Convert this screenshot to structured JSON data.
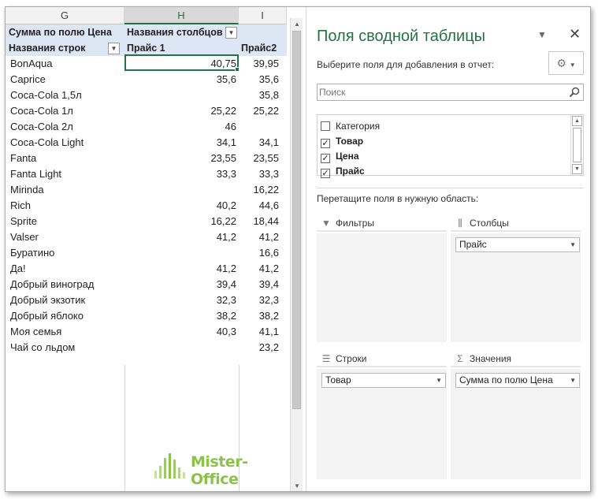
{
  "sheet": {
    "columns": [
      "G",
      "H",
      "I"
    ],
    "header_row1": {
      "g": "Сумма по полю Цена",
      "h": "Названия столбцов"
    },
    "header_row2": {
      "g": "Названия строк",
      "h": "Прайс 1",
      "i": "Прайс2"
    },
    "rows": [
      {
        "name": "BonAqua",
        "p1": "40,75",
        "p2": "39,95"
      },
      {
        "name": "Caprice",
        "p1": "35,6",
        "p2": "35,6"
      },
      {
        "name": "Coca-Cola 1,5л",
        "p1": "",
        "p2": "35,8"
      },
      {
        "name": "Coca-Cola 1л",
        "p1": "25,22",
        "p2": "25,22"
      },
      {
        "name": "Coca-Cola 2л",
        "p1": "46",
        "p2": ""
      },
      {
        "name": "Coca-Cola Light",
        "p1": "34,1",
        "p2": "34,1"
      },
      {
        "name": "Fanta",
        "p1": "23,55",
        "p2": "23,55"
      },
      {
        "name": "Fanta Light",
        "p1": "33,3",
        "p2": "33,3"
      },
      {
        "name": "Mirinda",
        "p1": "",
        "p2": "16,22"
      },
      {
        "name": "Rich",
        "p1": "40,2",
        "p2": "44,6"
      },
      {
        "name": "Sprite",
        "p1": "16,22",
        "p2": "18,44"
      },
      {
        "name": "Valser",
        "p1": "41,2",
        "p2": "41,2"
      },
      {
        "name": "Буратино",
        "p1": "",
        "p2": "16,6"
      },
      {
        "name": "Да!",
        "p1": "41,2",
        "p2": "41,2"
      },
      {
        "name": "Добрый виноград",
        "p1": "39,4",
        "p2": "39,4"
      },
      {
        "name": "Добрый экзотик",
        "p1": "32,3",
        "p2": "32,3"
      },
      {
        "name": "Добрый яблоко",
        "p1": "38,2",
        "p2": "38,2"
      },
      {
        "name": "Моя семья",
        "p1": "40,3",
        "p2": "41,1"
      },
      {
        "name": "Чай со льдом",
        "p1": "",
        "p2": "23,2"
      }
    ]
  },
  "pane": {
    "title": "Поля сводной таблицы",
    "subtitle": "Выберите поля для добавления в отчет:",
    "search_placeholder": "Поиск",
    "fields": [
      {
        "label": "Категория",
        "checked": false
      },
      {
        "label": "Товар",
        "checked": true
      },
      {
        "label": "Цена",
        "checked": true
      },
      {
        "label": "Прайс",
        "checked": true
      }
    ],
    "drag_hint": "Перетащите поля в нужную область:",
    "areas": {
      "filters": {
        "label": "Фильтры"
      },
      "columns": {
        "label": "Столбцы",
        "chip": "Прайс"
      },
      "rows": {
        "label": "Строки",
        "chip": "Товар"
      },
      "values": {
        "label": "Значения",
        "chip": "Сумма по полю Цена"
      }
    }
  },
  "watermark": {
    "text": "Mister-Office"
  },
  "colors": {
    "accent": "#217346",
    "pivot_header": "#dde6f5",
    "watermark": "#8bc34a"
  }
}
